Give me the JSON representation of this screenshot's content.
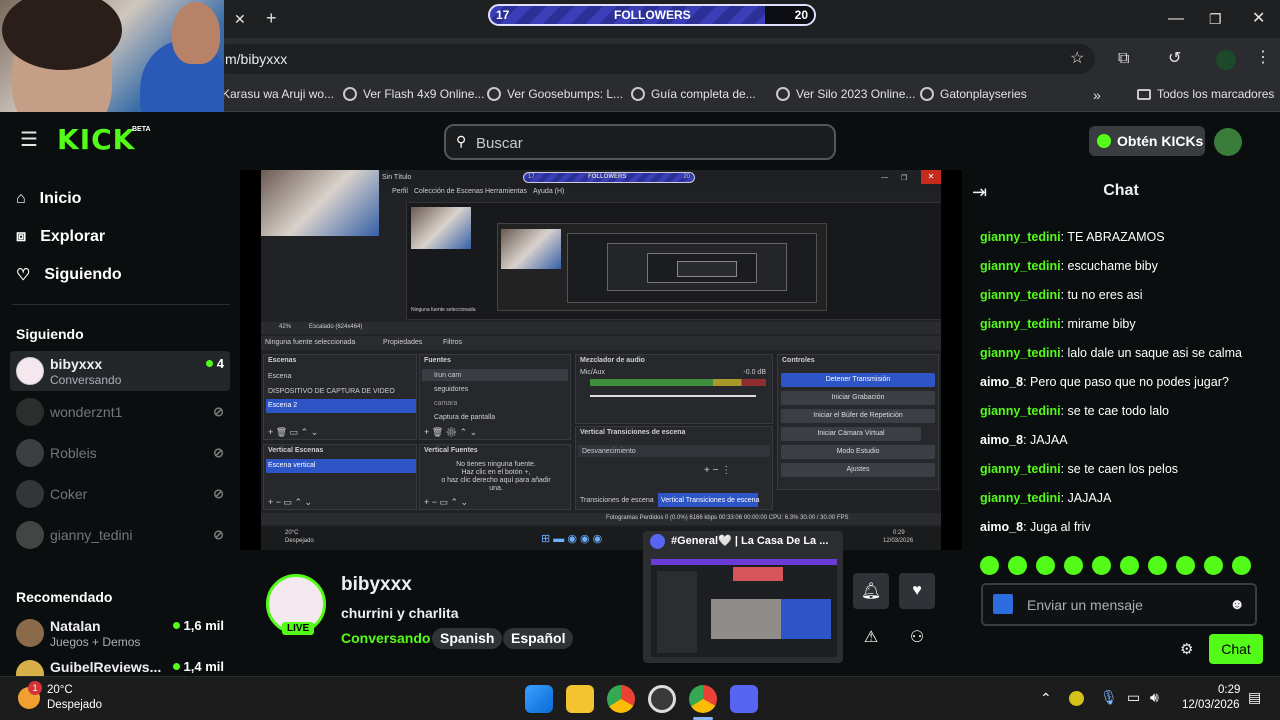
{
  "overlay": {
    "followers_label": "FOLLOWERS",
    "followers_current": "17",
    "followers_goal": "20",
    "progress_fraction": 0.85
  },
  "browser": {
    "url": "m/bibyxxx",
    "bookmarks": [
      "Karasu wa Aruji wo...",
      "Ver Flash 4x9 Online...",
      "Ver Goosebumps: L...",
      "Guía completa de...",
      "Ver Silo 2023 Online...",
      "Gatonplayseries"
    ],
    "all_bookmarks": "Todos los marcadores"
  },
  "kick": {
    "logo": "KICK",
    "logo_beta": "BETA",
    "search_placeholder": "Buscar",
    "get_kicks": "Obtén KICKs"
  },
  "sidebar": {
    "nav": [
      "Inicio",
      "Explorar",
      "Siguiendo"
    ],
    "following_title": "Siguiendo",
    "following": [
      {
        "name": "bibyxxx",
        "sub": "Conversando",
        "viewers": "4"
      },
      {
        "name": "wonderznt1"
      },
      {
        "name": "Robleis"
      },
      {
        "name": "Coker"
      },
      {
        "name": "gianny_tedini"
      }
    ],
    "recommended_title": "Recomendado",
    "recommended": [
      {
        "name": "Natalan",
        "sub": "Juegos + Demos",
        "viewers": "1,6 mil"
      },
      {
        "name": "GuibelReviews...",
        "viewers": "1,4 mil"
      }
    ]
  },
  "obs": {
    "window_title": "Sin Título",
    "menu": [
      "Perfil",
      "Colección de Escenas",
      "Herramientas",
      "Ayuda (H)"
    ],
    "overlay_left": "17",
    "overlay_mid": "FOLLOWERS",
    "overlay_right": "20",
    "no_source": "Ninguna fuente seleccionada",
    "properties": "Propiedades",
    "filters": "Filtros",
    "zoom": "42%",
    "scaled": "Escalado (624x464)",
    "scenes_title": "Escenas",
    "scenes": [
      "Escena",
      "DISPOSITIVO DE CAPTURA DE VIDEO",
      "Escena 2"
    ],
    "sources_title": "Fuentes",
    "sources": [
      "Irun cam",
      "seguidores",
      "camara",
      "Captura de pantalla"
    ],
    "mixer_title": "Mezclador de audio",
    "mixer_track": "Mic/Aux",
    "mixer_db": "-0.0 dB",
    "controls_title": "Controles",
    "controls": [
      "Detener Transmisión",
      "Iniciar Grabación",
      "Iniciar el Búfer de Repetición",
      "Iniciar Cámara Virtual",
      "Modo Estudio",
      "Ajustes"
    ],
    "vscenes_title": "Vertical Escenas",
    "vscenes": [
      "Escena vertical"
    ],
    "vsources_title": "Vertical Fuentes",
    "vsources_empty": "No tienes ninguna fuente.\nHaz clic en el botón +,\no haz clic derecho aquí para añadir\nuna.",
    "vtrans_title": "Vertical Transiciones de escena",
    "vtrans_value": "Desvanecimiento",
    "tab_transitions": "Transiciones de escena",
    "tab_vtransitions": "Vertical Transiciones de escena",
    "status": "Fotogramas Perdidos 0 (0.0%)   6166 kbps   00:33:06   00:00:00   CPU: 6.3%   30.00 / 30.00 FPS",
    "weather_temp": "20°C",
    "weather_desc": "Despejado",
    "clock_time": "0:29",
    "clock_date": "12/03/2026"
  },
  "stream": {
    "name": "bibyxxx",
    "title": "churrini y charlita",
    "category": "Conversando",
    "tags": [
      "Spanish",
      "Español"
    ],
    "live": "LIVE"
  },
  "discord": {
    "title": "#General🤍 | La Casa De La ..."
  },
  "chat": {
    "title": "Chat",
    "messages": [
      {
        "user": "gianny_tedini",
        "color": "#53fc18",
        "text": "TE ABRAZAMOS"
      },
      {
        "user": "gianny_tedini",
        "color": "#53fc18",
        "text": "escuchame biby"
      },
      {
        "user": "gianny_tedini",
        "color": "#53fc18",
        "text": "tu no eres asi"
      },
      {
        "user": "gianny_tedini",
        "color": "#53fc18",
        "text": "mirame biby"
      },
      {
        "user": "gianny_tedini",
        "color": "#53fc18",
        "text": "lalo dale un saque asi se calma"
      },
      {
        "user": "aimo_8",
        "color": "#ffffff",
        "text": "Pero que paso que no podes jugar?"
      },
      {
        "user": "gianny_tedini",
        "color": "#53fc18",
        "text": "se te cae todo lalo"
      },
      {
        "user": "aimo_8",
        "color": "#ffffff",
        "text": "JAJAA"
      },
      {
        "user": "gianny_tedini",
        "color": "#53fc18",
        "text": "se te caen los pelos"
      },
      {
        "user": "gianny_tedini",
        "color": "#53fc18",
        "text": "JAJAJA"
      },
      {
        "user": "aimo_8",
        "color": "#ffffff",
        "text": "Juga al friv"
      }
    ],
    "input_placeholder": "Enviar un mensaje",
    "send_label": "Chat"
  },
  "taskbar": {
    "weather_temp": "20°C",
    "weather_desc": "Despejado",
    "weather_badge": "1",
    "time": "0:29",
    "date": "12/03/2026"
  },
  "colors": {
    "accent": "#53fc18",
    "background": "#0b0e0f",
    "obs_selection": "#2d55c5"
  }
}
